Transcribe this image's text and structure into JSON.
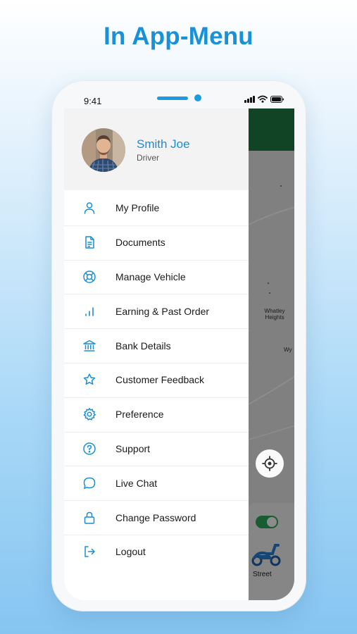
{
  "headline": "In App-Menu",
  "status_bar": {
    "time": "9:41"
  },
  "profile": {
    "name": "Smith Joe",
    "role": "Driver"
  },
  "menu": [
    {
      "label": "My Profile",
      "icon": "user-icon"
    },
    {
      "label": "Documents",
      "icon": "document-icon"
    },
    {
      "label": "Manage Vehicle",
      "icon": "lifebuoy-icon"
    },
    {
      "label": "Earning & Past Order",
      "icon": "bar-chart-icon"
    },
    {
      "label": "Bank Details",
      "icon": "bank-icon"
    },
    {
      "label": "Customer Feedback",
      "icon": "star-icon"
    },
    {
      "label": "Preference",
      "icon": "gear-icon"
    },
    {
      "label": "Support",
      "icon": "help-circle-icon"
    },
    {
      "label": "Live Chat",
      "icon": "chat-bubble-icon"
    },
    {
      "label": "Change Password",
      "icon": "lock-icon"
    },
    {
      "label": "Logout",
      "icon": "logout-icon"
    }
  ],
  "map": {
    "labels": [
      "Whatley Heights",
      "Wy"
    ],
    "vehicle_label": "Street",
    "online_toggle": true
  },
  "colors": {
    "accent": "#1b8ed3",
    "headline": "#1791d8",
    "map_header": "#1f7c44",
    "toggle_on": "#2ea85a"
  }
}
